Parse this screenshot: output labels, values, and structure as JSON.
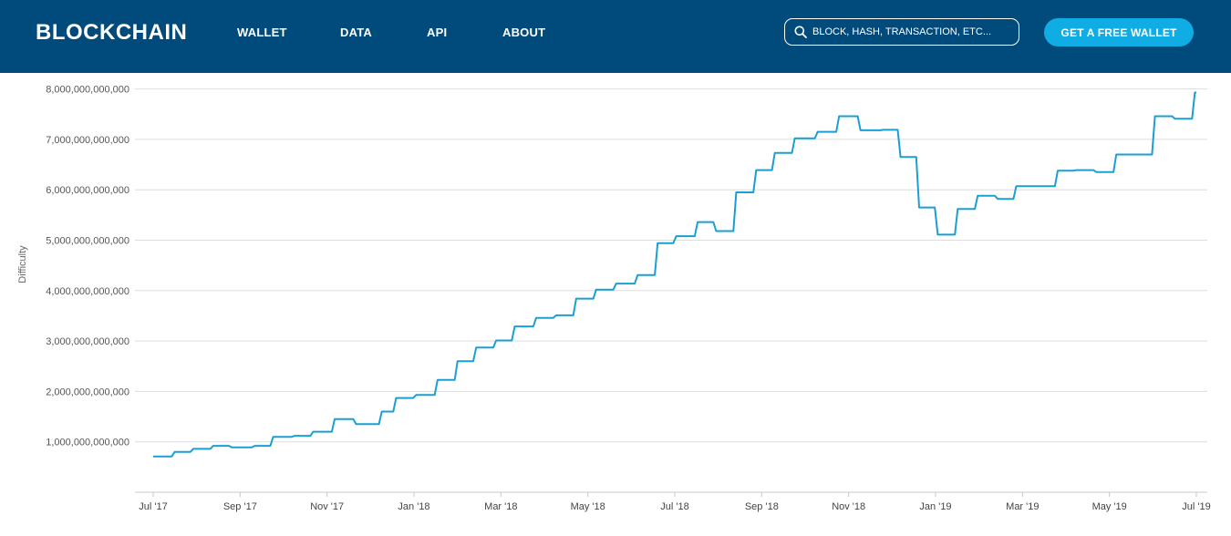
{
  "header": {
    "logo": "BLOCKCHAIN",
    "nav": [
      "WALLET",
      "DATA",
      "API",
      "ABOUT"
    ],
    "search_placeholder": "BLOCK, HASH, TRANSACTION, ETC...",
    "cta_label": "GET A FREE WALLET"
  },
  "colors": {
    "header_bg": "#004a7c",
    "cta_bg": "#10ade4",
    "line": "#1a9fd4",
    "grid": "#dddddd"
  },
  "chart_data": {
    "type": "line",
    "title": "",
    "xlabel": "",
    "ylabel": "Difficulty",
    "ylim": [
      0,
      8000000000000
    ],
    "xlim": [
      "2017-07-01",
      "2019-07-01"
    ],
    "grid": true,
    "x_ticks": [
      "Jul '17",
      "Sep '17",
      "Nov '17",
      "Jan '18",
      "Mar '18",
      "May '18",
      "Jul '18",
      "Sep '18",
      "Nov '18",
      "Jan '19",
      "Mar '19",
      "May '19",
      "Jul '19"
    ],
    "y_ticks": [
      "1,000,000,000,000",
      "2,000,000,000,000",
      "3,000,000,000,000",
      "4,000,000,000,000",
      "5,000,000,000,000",
      "6,000,000,000,000",
      "7,000,000,000,000",
      "8,000,000,000,000"
    ],
    "series": [
      {
        "x": [
          "2017-07-01",
          "2017-07-14",
          "2017-07-16",
          "2017-07-27",
          "2017-07-29",
          "2017-08-10",
          "2017-08-12",
          "2017-08-23",
          "2017-08-25",
          "2017-09-08",
          "2017-09-10",
          "2017-09-21",
          "2017-09-23",
          "2017-10-06",
          "2017-10-08",
          "2017-10-19",
          "2017-10-21",
          "2017-11-03",
          "2017-11-05",
          "2017-11-18",
          "2017-11-20",
          "2017-12-06",
          "2017-12-08",
          "2017-12-16",
          "2017-12-18",
          "2017-12-30",
          "2018-01-01",
          "2018-01-14",
          "2018-01-16",
          "2018-01-28",
          "2018-01-30",
          "2018-02-10",
          "2018-02-12",
          "2018-02-24",
          "2018-02-26",
          "2018-03-09",
          "2018-03-11",
          "2018-03-24",
          "2018-03-26",
          "2018-04-07",
          "2018-04-09",
          "2018-04-21",
          "2018-04-23",
          "2018-05-05",
          "2018-05-07",
          "2018-05-19",
          "2018-05-21",
          "2018-06-03",
          "2018-06-05",
          "2018-06-17",
          "2018-06-19",
          "2018-06-30",
          "2018-07-02",
          "2018-07-15",
          "2018-07-17",
          "2018-07-28",
          "2018-07-30",
          "2018-08-11",
          "2018-08-13",
          "2018-08-25",
          "2018-08-27",
          "2018-09-07",
          "2018-09-09",
          "2018-09-21",
          "2018-09-23",
          "2018-10-07",
          "2018-10-09",
          "2018-10-22",
          "2018-10-24",
          "2018-11-06",
          "2018-11-08",
          "2018-11-22",
          "2018-11-24",
          "2018-12-04",
          "2018-12-06",
          "2018-12-17",
          "2018-12-19",
          "2018-12-30",
          "2019-01-01",
          "2019-01-13",
          "2019-01-15",
          "2019-01-27",
          "2019-01-29",
          "2019-02-10",
          "2019-02-12",
          "2019-02-23",
          "2019-02-25",
          "2019-03-09",
          "2019-03-11",
          "2019-03-24",
          "2019-03-26",
          "2019-04-06",
          "2019-04-08",
          "2019-04-20",
          "2019-04-22",
          "2019-05-04",
          "2019-05-06",
          "2019-05-18",
          "2019-05-20",
          "2019-05-31",
          "2019-06-02",
          "2019-06-14",
          "2019-06-16",
          "2019-06-28",
          "2019-06-30",
          "2019-07-01"
        ],
        "y": [
          710000000000.0,
          710000000000.0,
          800000000000.0,
          800000000000.0,
          860000000000.0,
          860000000000.0,
          920000000000.0,
          920000000000.0,
          890000000000.0,
          890000000000.0,
          920000000000.0,
          920000000000.0,
          1100000000000.0,
          1100000000000.0,
          1120000000000.0,
          1120000000000.0,
          1200000000000.0,
          1200000000000.0,
          1450000000000.0,
          1450000000000.0,
          1350000000000.0,
          1350000000000.0,
          1600000000000.0,
          1600000000000.0,
          1870000000000.0,
          1870000000000.0,
          1930000000000.0,
          1930000000000.0,
          2230000000000.0,
          2230000000000.0,
          2600000000000.0,
          2600000000000.0,
          2870000000000.0,
          2870000000000.0,
          3010000000000.0,
          3010000000000.0,
          3290000000000.0,
          3290000000000.0,
          3460000000000.0,
          3460000000000.0,
          3510000000000.0,
          3510000000000.0,
          3840000000000.0,
          3840000000000.0,
          4020000000000.0,
          4020000000000.0,
          4140000000000.0,
          4140000000000.0,
          4310000000000.0,
          4310000000000.0,
          4940000000000.0,
          4940000000000.0,
          5080000000000.0,
          5080000000000.0,
          5360000000000.0,
          5360000000000.0,
          5180000000000.0,
          5180000000000.0,
          5950000000000.0,
          5950000000000.0,
          6390000000000.0,
          6390000000000.0,
          6730000000000.0,
          6730000000000.0,
          7020000000000.0,
          7020000000000.0,
          7150000000000.0,
          7150000000000.0,
          7460000000000.0,
          7460000000000.0,
          7180000000000.0,
          7180000000000.0,
          7190000000000.0,
          7190000000000.0,
          6650000000000.0,
          6650000000000.0,
          5650000000000.0,
          5650000000000.0,
          5110000000000.0,
          5110000000000.0,
          5620000000000.0,
          5620000000000.0,
          5880000000000.0,
          5880000000000.0,
          5820000000000.0,
          5820000000000.0,
          6070000000000.0,
          6070000000000.0,
          6070000000000.0,
          6070000000000.0,
          6380000000000.0,
          6380000000000.0,
          6390000000000.0,
          6390000000000.0,
          6350000000000.0,
          6350000000000.0,
          6700000000000.0,
          6700000000000.0,
          6700000000000.0,
          6700000000000.0,
          7460000000000.0,
          7460000000000.0,
          7410000000000.0,
          7410000000000.0,
          7930000000000.0,
          7930000000000.0
        ]
      }
    ]
  }
}
